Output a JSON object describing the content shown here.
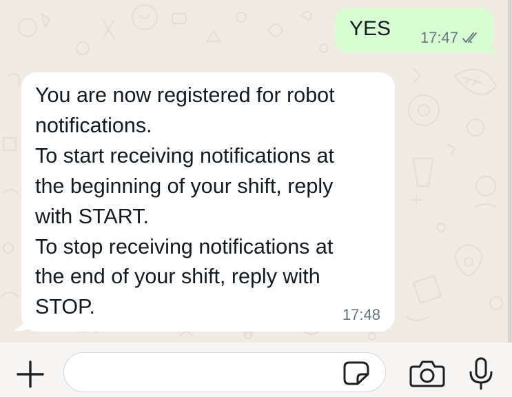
{
  "messages": {
    "outgoing": {
      "text": "YES",
      "time": "17:47",
      "status_icon": "double-check-icon"
    },
    "incoming": {
      "lines": [
        "You are now registered for robot",
        "notifications.",
        "To start receiving notifications at",
        "the beginning of your shift, reply",
        "with START.",
        "To stop receiving notifications at",
        "the end of your shift, reply with",
        "STOP."
      ],
      "time": "17:48"
    }
  },
  "composer": {
    "placeholder": "",
    "value": "",
    "icons": [
      "plus-icon",
      "sticker-icon",
      "camera-icon",
      "microphone-icon"
    ]
  },
  "colors": {
    "chat_background": "#efeae2",
    "outgoing_bubble": "#d9fdd3",
    "incoming_bubble": "#ffffff",
    "meta_text": "#667781",
    "icon_color": "#1f1f1f"
  }
}
